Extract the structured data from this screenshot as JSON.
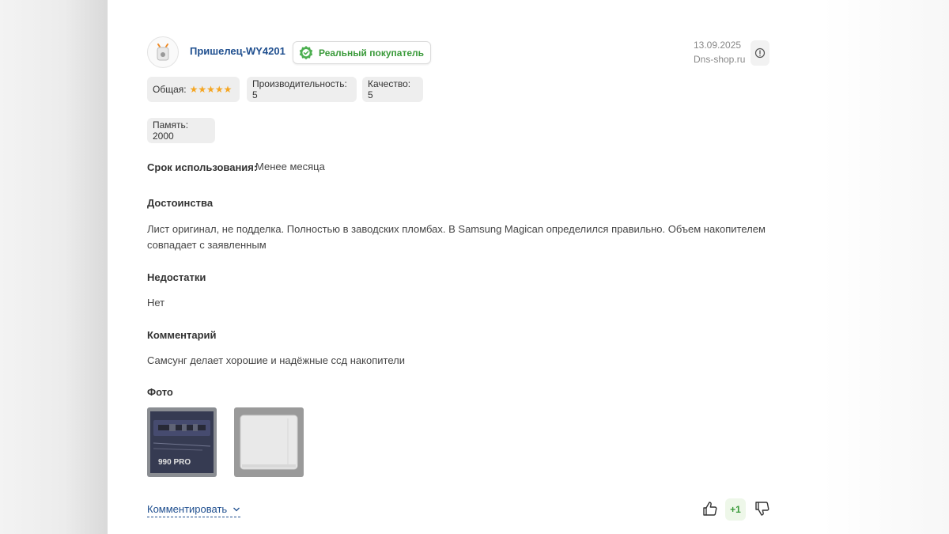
{
  "review": {
    "username": "Пришелец-WY4201",
    "badge": "Реальный покупатель",
    "date": "13.09.2025",
    "source": "Dns-shop.ru",
    "ratings": {
      "overall_label": "Общая:",
      "overall_stars": 5,
      "stars_text": "★★★★★",
      "performance": "Производительность: 5",
      "quality": "Качество: 5",
      "memory": "Память: 2000"
    },
    "usage_label": "Срок использования:",
    "usage_value": "Менее месяца",
    "pros_title": "Достоинства",
    "pros_line1": "Лист оригинал, не подделка. Полностью в заводских пломбах. В Samsung Magican определился правильно. Объем накопителем",
    "pros_line2": "совпадает с заявленным",
    "cons_title": "Недостатки",
    "cons_text": "Нет",
    "comment_title": "Комментарий",
    "comment_text": "Самсунг делает хорошие и надёжные ссд накопители",
    "photos_title": "Фото",
    "photo1_text": "990 PRO",
    "comment_action": "Комментировать",
    "votes": "+1"
  },
  "colors": {
    "accent_blue": "#1f4f8f",
    "green": "#3a9a3a",
    "star": "#f5a623"
  }
}
